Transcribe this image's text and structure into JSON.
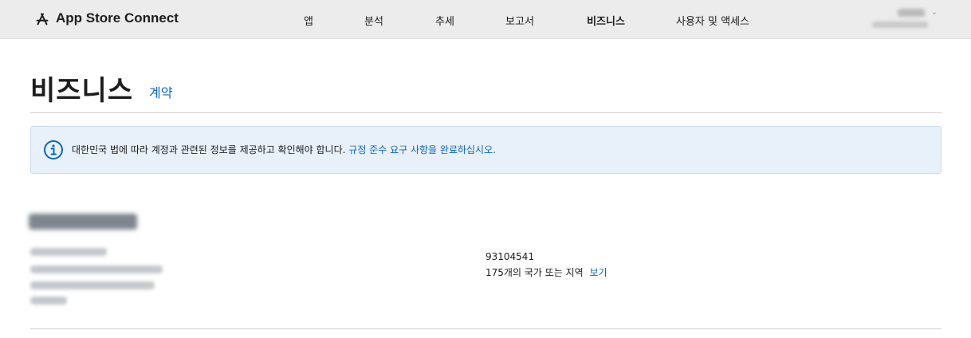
{
  "header": {
    "brand": "App Store Connect",
    "brand_icon": "app-store-icon",
    "nav": [
      {
        "label": "앱",
        "active": false
      },
      {
        "label": "분석",
        "active": false
      },
      {
        "label": "추세",
        "active": false
      },
      {
        "label": "보고서",
        "active": false
      },
      {
        "label": "비즈니스",
        "active": true
      },
      {
        "label": "사용자 및 액세스",
        "active": false
      }
    ]
  },
  "page": {
    "title": "비즈니스",
    "tab": "계약"
  },
  "notice": {
    "icon": "info-icon",
    "text": "대한민국 법에 따라 계정과 관련된 정보를 제공하고 확인해야 합니다.",
    "link": "규정 준수 요구 사항을 완료하십시오."
  },
  "account": {
    "number": "93104541",
    "territories": "175개의 국가 또는 지역",
    "view_link": "보기"
  },
  "colors": {
    "accent": "#0a66c2",
    "header_bg": "#ececec",
    "notice_bg": "#e8f1fa"
  }
}
